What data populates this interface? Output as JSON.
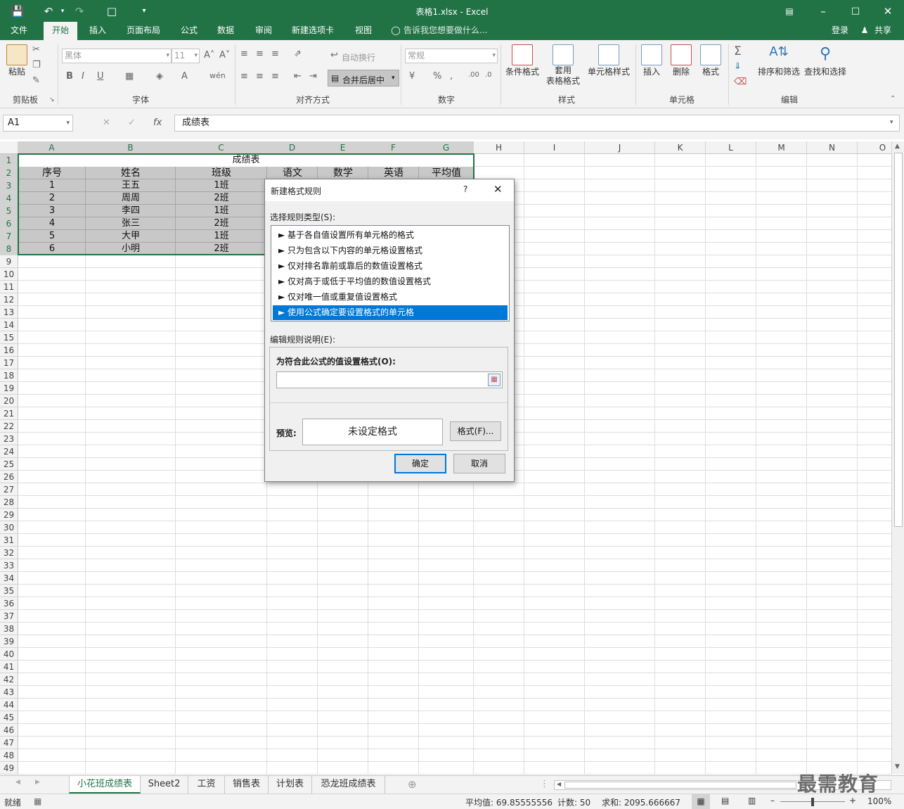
{
  "titlebar": {
    "title": "表格1.xlsx - Excel"
  },
  "ribbon_tabs": [
    "文件",
    "开始",
    "插入",
    "页面布局",
    "公式",
    "数据",
    "审阅",
    "新建选项卡",
    "视图"
  ],
  "tell_me": "告诉我您想要做什么...",
  "account": {
    "login": "登录",
    "share": "共享"
  },
  "ribbon": {
    "clipboard": {
      "paste": "粘贴",
      "label": "剪贴板"
    },
    "font": {
      "name": "黑体",
      "size": "11",
      "label": "字体"
    },
    "alignment": {
      "wrap": "自动换行",
      "merge": "合并后居中",
      "label": "对齐方式"
    },
    "number": {
      "format": "常规",
      "label": "数字"
    },
    "styles": {
      "cond": "条件格式",
      "table1": "套用",
      "table2": "表格格式",
      "cell": "单元格样式",
      "label": "样式"
    },
    "cells": {
      "insert": "插入",
      "delete": "删除",
      "format": "格式",
      "label": "单元格"
    },
    "editing": {
      "sort": "排序和筛选",
      "find": "查找和选择",
      "label": "编辑"
    }
  },
  "formula_bar": {
    "namebox": "A1",
    "content": "成绩表"
  },
  "columns": [
    "A",
    "B",
    "C",
    "D",
    "E",
    "F",
    "G",
    "H",
    "I",
    "J",
    "K",
    "L",
    "M",
    "N",
    "O"
  ],
  "rows_count": 49,
  "sheet": {
    "title": "成绩表",
    "headers": [
      "序号",
      "姓名",
      "班级",
      "语文",
      "数学",
      "英语",
      "平均值"
    ],
    "rows": [
      [
        "1",
        "王五",
        "1班"
      ],
      [
        "2",
        "周周",
        "2班"
      ],
      [
        "3",
        "李四",
        "1班"
      ],
      [
        "4",
        "张三",
        "2班"
      ],
      [
        "5",
        "大甲",
        "1班"
      ],
      [
        "6",
        "小明",
        "2班"
      ]
    ]
  },
  "dialog": {
    "title": "新建格式规则",
    "help": "?",
    "rule_type_label": "选择规则类型(S):",
    "rules": [
      "► 基于各自值设置所有单元格的格式",
      "► 只为包含以下内容的单元格设置格式",
      "► 仅对排名靠前或靠后的数值设置格式",
      "► 仅对高于或低于平均值的数值设置格式",
      "► 仅对唯一值或重复值设置格式",
      "► 使用公式确定要设置格式的单元格"
    ],
    "selected_rule": 5,
    "edit_label": "编辑规则说明(E):",
    "formula_label": "为符合此公式的值设置格式(O):",
    "formula_value": "",
    "preview_label": "预览:",
    "preview_text": "未设定格式",
    "format_button": "格式(F)...",
    "ok": "确定",
    "cancel": "取消"
  },
  "sheet_tabs": [
    "小花班成绩表",
    "Sheet2",
    "工资",
    "销售表",
    "计划表",
    "恐龙班成绩表"
  ],
  "active_sheet": 0,
  "status": {
    "ready": "就绪",
    "average": "平均值: 69.85555556",
    "count": "计数: 50",
    "sum": "求和: 2095.666667",
    "zoom": "100%"
  },
  "watermark": "最需教育",
  "colors": {
    "excel_green": "#217346",
    "selection_blue": "#0078d7"
  }
}
